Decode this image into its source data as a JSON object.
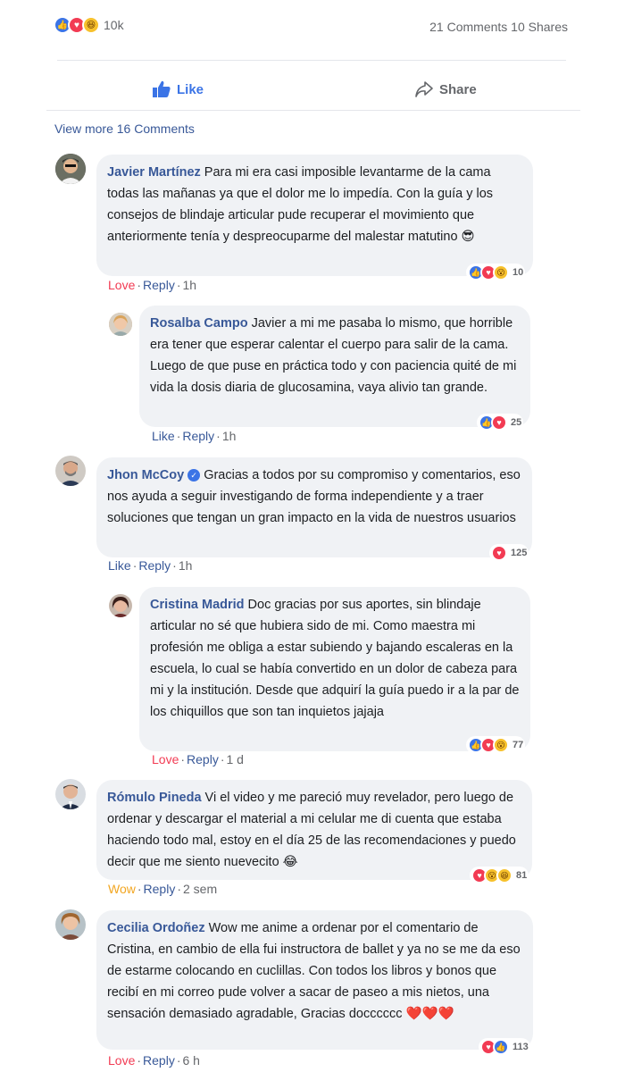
{
  "summary": {
    "count": "10k",
    "comments_shares": "21 Comments 10 Shares"
  },
  "actions": {
    "like": "Like",
    "share": "Share"
  },
  "view_more": "View more 16 Comments",
  "comments": [
    {
      "author": "Javier Martínez",
      "text": "Para mi era casi imposible levantarme de la cama todas las mañanas ya que el dolor me lo impedía. Con la guía y los consejos de blindaje articular pude recuperar el movimiento que anteriormente tenía y despreocuparme del malestar matutino 😎",
      "reaction_label": "Love",
      "reply": "Reply",
      "time": "1h",
      "react_count": "10"
    },
    {
      "author": "Rosalba Campo",
      "text": "Javier a mi me pasaba lo mismo, que horrible era tener que esperar calentar el cuerpo para salir de la cama. Luego de que puse en práctica todo y con paciencia quité de mi vida la dosis diaria de glucosamina, vaya alivio tan grande.",
      "reaction_label": "Like",
      "reply": "Reply",
      "time": "1h",
      "react_count": "25"
    },
    {
      "author": "Jhon McCoy",
      "text": "Gracias a todos por su compromiso y comentarios, eso nos ayuda a seguir investigando de forma independiente y a traer soluciones que tengan un gran impacto en la vida de nuestros usuarios",
      "reaction_label": "Like",
      "reply": "Reply",
      "time": "1h",
      "react_count": "125"
    },
    {
      "author": "Cristina Madrid",
      "text": "Doc gracias por sus aportes, sin blindaje articular no sé que hubiera sido de mi. Como maestra mi profesión me obliga a estar subiendo y bajando escaleras en la escuela, lo cual se había convertido en un dolor de cabeza para mi y la institución. Desde que adquirí la guía puedo ir a la par de los chiquillos que son tan inquietos jajaja",
      "reaction_label": "Love",
      "reply": "Reply",
      "time": "1 d",
      "react_count": "77"
    },
    {
      "author": "Rómulo Pineda",
      "text": "Vi el video y me pareció muy revelador, pero luego de ordenar y descargar el material a mi celular me di cuenta que estaba haciendo todo mal, estoy en el día 25 de las recomendaciones y puedo decir que me siento nuevecito 😂",
      "reaction_label": "Wow",
      "reply": "Reply",
      "time": "2 sem",
      "react_count": "81"
    },
    {
      "author": "Cecilia Ordoñez",
      "text": "Wow me anime a ordenar por el comentario de Cristina, en cambio de ella fui instructora de ballet y ya no se me da eso de estarme colocando en cuclillas. Con todos los libros y bonos que recibí en mi correo pude volver a sacar de paseo a mis nietos, una sensación demasiado agradable, Gracias docccccc ❤️❤️❤️",
      "reaction_label": "Love",
      "reply": "Reply",
      "time": "6 h",
      "react_count": "113"
    }
  ],
  "colors": {
    "link": "#385898",
    "like_blue": "#3b74e6",
    "love_red": "#f23b53",
    "bubble_bg": "#f0f2f5",
    "muted": "#65676b"
  }
}
